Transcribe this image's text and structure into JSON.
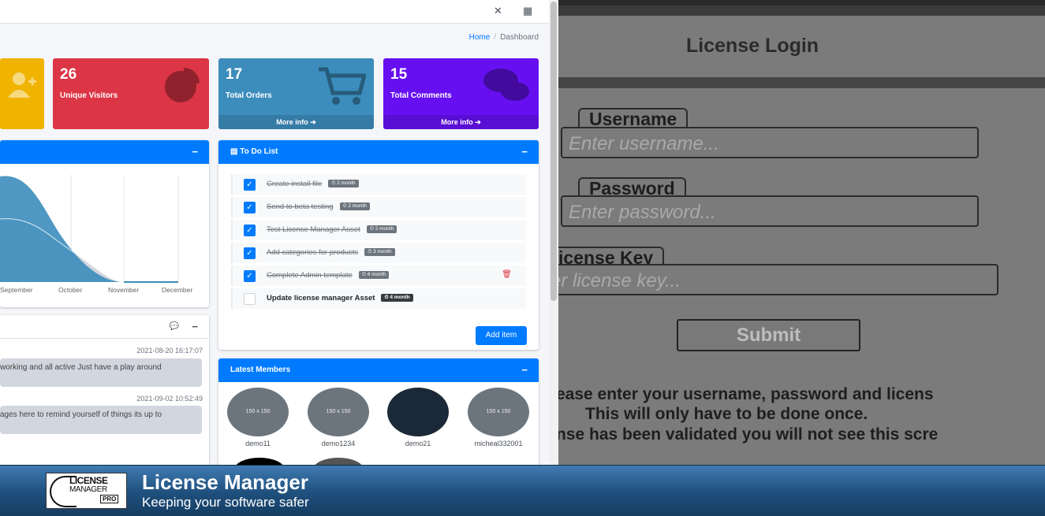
{
  "dashboard": {
    "breadcrumb": {
      "home": "Home",
      "separator": "/",
      "current": "Dashboard"
    },
    "info_boxes": [
      {
        "number": "",
        "label": "",
        "color": "#f0b300",
        "icon": "user-plus-icon"
      },
      {
        "number": "26",
        "label": "Unique Visitors",
        "color": "#dc3545",
        "icon": "pie-chart-icon"
      },
      {
        "number": "17",
        "label": "Total Orders",
        "color": "#3c8dbc",
        "icon": "cart-icon",
        "more": "More info"
      },
      {
        "number": "15",
        "label": "Total Comments",
        "color": "#6610f2",
        "icon": "comments-icon",
        "more": "More info"
      }
    ],
    "chart": {
      "months": [
        "September",
        "October",
        "November",
        "December"
      ]
    },
    "todo": {
      "title": "To Do List",
      "items": [
        {
          "text": "Create install file",
          "badge": "2 month",
          "done": true
        },
        {
          "text": "Send to beta testing",
          "badge": "2 month",
          "done": true
        },
        {
          "text": "Test License Manager Asset",
          "badge": "2 month",
          "done": true
        },
        {
          "text": "Add categories for products",
          "badge": "3 month",
          "done": true
        },
        {
          "text": "Complete Admin template",
          "badge": "4 month",
          "done": true
        },
        {
          "text": "Update license manager Asset",
          "badge": "4 month",
          "done": false
        }
      ],
      "add_button": "Add item"
    },
    "chat": {
      "messages": [
        {
          "time": "2021-08-20 16:17:07",
          "text": "working and all active Just have a play around"
        },
        {
          "time": "2021-09-02 10:52:49",
          "text": "ages here to remind yourself of things its up to"
        }
      ]
    },
    "members": {
      "title": "Latest Members",
      "list": [
        {
          "name": "demo11",
          "avatar": "150 x 150"
        },
        {
          "name": "demo1234",
          "avatar": "150 x 150"
        },
        {
          "name": "demo21",
          "avatar": ""
        },
        {
          "name": "micheal332001",
          "avatar": "150 x 150"
        }
      ]
    }
  },
  "login": {
    "title": "License Login",
    "username_label": "Username",
    "username_placeholder": "Enter username...",
    "password_label": "Password",
    "password_placeholder": "Enter password...",
    "license_label": "icense Key",
    "license_placeholder": "er license key...",
    "submit": "Submit",
    "note_lines": [
      "ease enter your username, password and licens",
      "This will only have to be done once.",
      "nse has been validated you will not see this scre"
    ]
  },
  "banner": {
    "logo_line1": "LICENSE",
    "logo_line2": "MANAGER",
    "logo_badge": "PRO",
    "title": "License Manager",
    "subtitle": "Keeping your software safer"
  }
}
